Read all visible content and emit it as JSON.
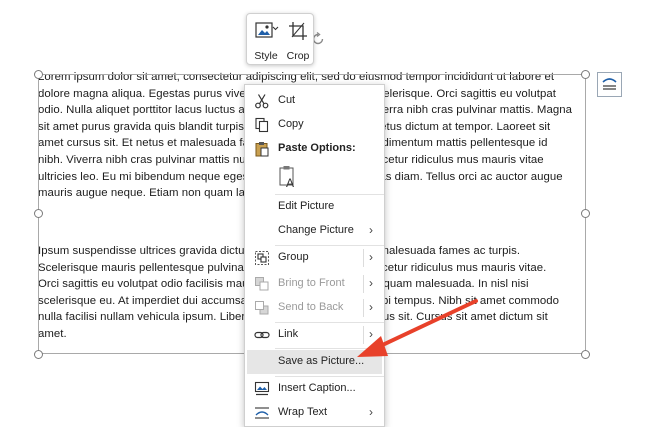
{
  "document": {
    "paragraph1": [
      "Lorem ipsum dolor sit amet, consectetur adipiscing elit, sed do eiusmod tempor incididunt ut labore et",
      "dolore magna aliqua. Egestas purus viverra accumsan in nisl nisi scelerisque. Orci sagittis eu volutpat",
      "odio. Nulla aliquet porttitor lacus luctus accumsan tortor posuere viverra nibh cras pulvinar mattis. Magna",
      "sit amet purus gravida quis blandit turpis cursus in hac habitasse metus dictum at tempor. Laoreet sit",
      "amet cursus sit. Et netus et malesuada fames ac turpis egestas condimentum mattis pellentesque id",
      "nibh. Viverra nibh cras pulvinar mattis nunc sed blandit libero ut nascetur ridiculus mus mauris vitae",
      "ultricies leo. Eu mi bibendum neque egestas congue quisque egestas diam. Tellus orci ac auctor augue",
      "mauris augue neque. Etiam non quam lacus"
    ],
    "paragraph2": [
      "Ipsum suspendisse ultrices gravida dictum fusce ut placerat orci et malesuada fames ac turpis.",
      "Scelerisque mauris pellentesque pulvinar pellentesque habitant nascetur ridiculus mus mauris vitae.",
      "Orci sagittis eu volutpat odio facilisis mauris sit amet massa vitae aliquam malesuada. In nisl nisi",
      "scelerisque eu. At imperdiet dui accumsan sit amet nulla facilisi morbi tempus. Nibh sit amet commodo",
      "nulla facilisi nullam vehicula ipsum. Libero justo laoreet sit amet varius sit. Cursus sit amet dictum sit",
      "amet."
    ]
  },
  "mini_toolbar": {
    "style_label": "Style",
    "crop_label": "Crop"
  },
  "context_menu": {
    "cut": "Cut",
    "copy": "Copy",
    "paste_options": "Paste Options:",
    "edit_picture": "Edit Picture",
    "change_picture": "Change Picture",
    "group": "Group",
    "bring_to_front": "Bring to Front",
    "send_to_back": "Send to Back",
    "link": "Link",
    "save_as_picture": "Save as Picture...",
    "insert_caption": "Insert Caption...",
    "wrap_text": "Wrap Text"
  },
  "colors": {
    "accent": "#1f5fa8",
    "arrow": "#e8412a",
    "highlight": "#e6e6e6"
  }
}
